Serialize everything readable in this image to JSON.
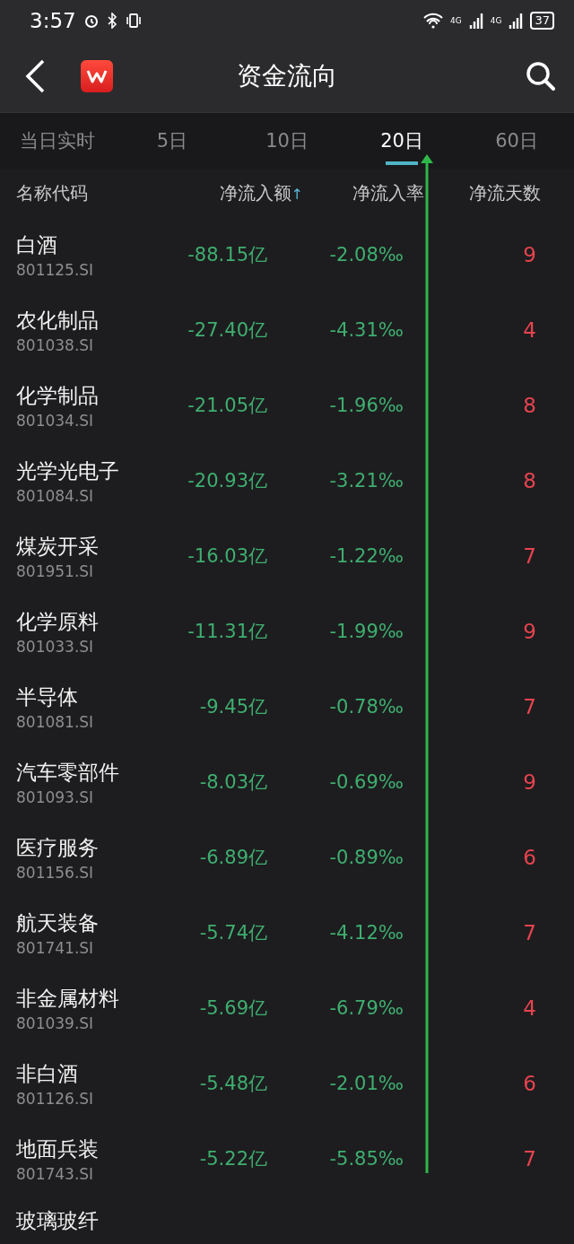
{
  "status_bar": {
    "time": "3:57",
    "battery": "37",
    "network_1": "4G",
    "network_2": "4G"
  },
  "header": {
    "title": "资金流向"
  },
  "tabs": [
    {
      "label": "当日实时",
      "selected": false
    },
    {
      "label": "5日",
      "selected": false
    },
    {
      "label": "10日",
      "selected": false
    },
    {
      "label": "20日",
      "selected": true
    },
    {
      "label": "60日",
      "selected": false
    }
  ],
  "table": {
    "columns": [
      {
        "label": "名称代码"
      },
      {
        "label": "净流入额",
        "sort_mark": "↑"
      },
      {
        "label": "净流入率"
      },
      {
        "label": "净流天数"
      }
    ],
    "rows": [
      {
        "name": "白酒",
        "code": "801125.SI",
        "amount": "-88.15亿",
        "rate": "-2.08‰",
        "days": "9"
      },
      {
        "name": "农化制品",
        "code": "801038.SI",
        "amount": "-27.40亿",
        "rate": "-4.31‰",
        "days": "4"
      },
      {
        "name": "化学制品",
        "code": "801034.SI",
        "amount": "-21.05亿",
        "rate": "-1.96‰",
        "days": "8"
      },
      {
        "name": "光学光电子",
        "code": "801084.SI",
        "amount": "-20.93亿",
        "rate": "-3.21‰",
        "days": "8"
      },
      {
        "name": "煤炭开采",
        "code": "801951.SI",
        "amount": "-16.03亿",
        "rate": "-1.22‰",
        "days": "7"
      },
      {
        "name": "化学原料",
        "code": "801033.SI",
        "amount": "-11.31亿",
        "rate": "-1.99‰",
        "days": "9"
      },
      {
        "name": "半导体",
        "code": "801081.SI",
        "amount": "-9.45亿",
        "rate": "-0.78‰",
        "days": "7"
      },
      {
        "name": "汽车零部件",
        "code": "801093.SI",
        "amount": "-8.03亿",
        "rate": "-0.69‰",
        "days": "9"
      },
      {
        "name": "医疗服务",
        "code": "801156.SI",
        "amount": "-6.89亿",
        "rate": "-0.89‰",
        "days": "6"
      },
      {
        "name": "航天装备",
        "code": "801741.SI",
        "amount": "-5.74亿",
        "rate": "-4.12‰",
        "days": "7"
      },
      {
        "name": "非金属材料",
        "code": "801039.SI",
        "amount": "-5.69亿",
        "rate": "-6.79‰",
        "days": "4"
      },
      {
        "name": "非白酒",
        "code": "801126.SI",
        "amount": "-5.48亿",
        "rate": "-2.01‰",
        "days": "6"
      },
      {
        "name": "地面兵装",
        "code": "801743.SI",
        "amount": "-5.22亿",
        "rate": "-5.85‰",
        "days": "7"
      },
      {
        "name": "玻璃玻纤"
      }
    ]
  }
}
